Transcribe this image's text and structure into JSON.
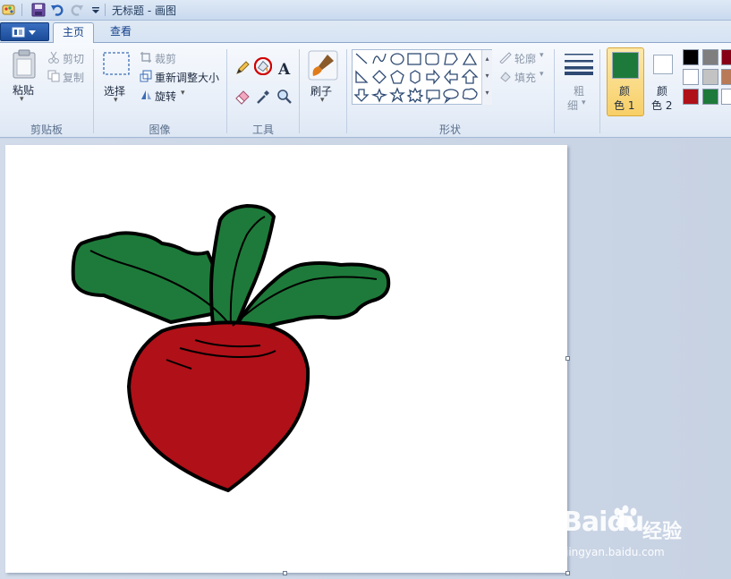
{
  "window": {
    "title": "无标题 - 画图"
  },
  "tabs": [
    {
      "label": "主页"
    },
    {
      "label": "查看"
    }
  ],
  "clipboard": {
    "paste": "粘贴",
    "cut": "剪切",
    "copy": "复制",
    "group": "剪贴板"
  },
  "image": {
    "select": "选择",
    "crop": "裁剪",
    "resize": "重新调整大小",
    "rotate": "旋转",
    "group": "图像"
  },
  "tools": {
    "group": "工具"
  },
  "brushes": {
    "label": "刷子"
  },
  "shapes": {
    "outline": "轮廓",
    "fill": "填充",
    "group": "形状"
  },
  "size": {
    "label_top": "粗",
    "label_bottom": "细"
  },
  "colors": {
    "color1_top": "颜",
    "color1_bottom": "色 1",
    "color2_top": "颜",
    "color2_bottom": "色 2",
    "color1_value": "#1e7a3a",
    "color2_value": "#ffffff",
    "palette": [
      "#000000",
      "#7f7f7f",
      "#880015",
      "#ffffff",
      "#c3c3c3",
      "#b97a57",
      "#b01018",
      "#1e7a3a",
      "#ffffff"
    ]
  },
  "drawing": {
    "leaf_color": "#1e7a3a",
    "bulb_color": "#b01018",
    "outline_color": "#000000"
  },
  "watermark": {
    "brand": "Baidu",
    "brand_cn": "经验",
    "url": "jingyan.baidu.com"
  }
}
